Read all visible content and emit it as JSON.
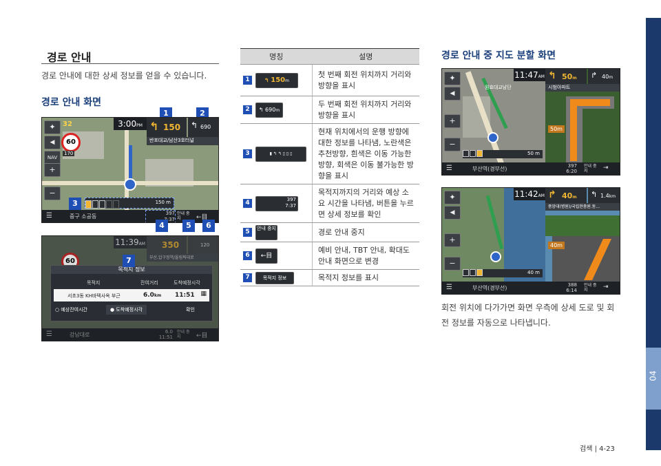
{
  "left": {
    "section_title": "경로 안내",
    "intro": "경로 안내에 대한 상세 정보를 얻을 수 있습니다.",
    "screen_title": "경로 안내 화면",
    "shot1": {
      "clock": "3:00",
      "clock_suffix": "PM",
      "speed": "60",
      "speed_small": "32",
      "dist_main": "150",
      "dist_unit": "m",
      "next_dist": "690",
      "next_unit": "m",
      "road_name": "반포대교/남산3호터널",
      "bottom_address": "중구 소공동",
      "remaining": "397",
      "eta": "7:37",
      "eta_suffix": "PM",
      "stop_label": "안내 중지",
      "lane_dist": "150 m",
      "scale": "170",
      "nav_label": "NAV"
    },
    "shot1_markers": [
      "1",
      "2",
      "3",
      "4",
      "5",
      "6"
    ],
    "shot2": {
      "clock": "11:39",
      "clock_suffix": "AM",
      "speed": "60",
      "dist_main": "350",
      "next_dist": "120",
      "road_name": "부산,압구정역/올림픽대로",
      "panel_title": "목적지 정보",
      "col_dest": "목적지",
      "col_remaining": "잔여거리",
      "col_eta": "도착예정시각",
      "dest_value": "서초3동 KH바텍사옥 부근",
      "remaining_value": "6.0",
      "remaining_unit": "km",
      "eta_value": "11:51",
      "option_remaining_time": "예상잔여시간",
      "option_eta": "도착예정시각",
      "confirm": "확인",
      "bottom_road": "강남대로",
      "bottom_remaining": "6.0",
      "bottom_eta": "11:51",
      "stop_label": "안내 중지"
    },
    "shot2_marker": "7"
  },
  "table": {
    "col_name": "명칭",
    "col_desc": "설명",
    "rows": [
      {
        "num": "1",
        "icon_text": "150",
        "icon_unit": "m",
        "desc": "첫 번째 회전 위치까지 거리와 방향을 표시"
      },
      {
        "num": "2",
        "icon_text": "690",
        "icon_unit": "m",
        "desc": "두 번째 회전 위치까지 거리와 방향을 표시"
      },
      {
        "num": "3",
        "icon_text": "",
        "icon_unit": "",
        "desc": "현재 위치에서의 운행 방향에 대한 정보를 나타냄, 노란색은 추천방향, 흰색은 이동 가능한 방향, 회색은 이동 불가능한 방향을 표시"
      },
      {
        "num": "4",
        "icon_text": "397",
        "icon_unit": "7:37",
        "desc": "목적지까지의 거리와 예상 소요 시간을 나타냄, 버튼을 누르면 상세 정보를 확인"
      },
      {
        "num": "5",
        "icon_text": "안내 중지",
        "icon_unit": "",
        "desc": "경로 안내 중지"
      },
      {
        "num": "6",
        "icon_text": "←目",
        "icon_unit": "",
        "desc": "예비 안내, TBT 안내, 확대도 안내 화면으로 변경"
      },
      {
        "num": "7",
        "icon_text": "목적지 정보",
        "icon_unit": "",
        "desc": "목적지 정보를 표시"
      }
    ]
  },
  "right": {
    "title": "경로 안내 중 지도 분할 화면",
    "shot3": {
      "clock": "11:47",
      "clock_suffix": "AM",
      "dist_main": "50",
      "dist_unit": "m",
      "next_dist": "40",
      "next_unit": "m",
      "poi": "시범아파트",
      "map_label": "원효대교남단",
      "box_dist": "50m",
      "lane_dist": "50 m",
      "bottom_road": "부산역(경부선)",
      "remaining": "397",
      "eta": "6:20",
      "eta_suffix": "PM",
      "stop_label": "안내 중지"
    },
    "shot4": {
      "clock": "11:42",
      "clock_suffix": "AM",
      "dist_main": "40",
      "dist_unit": "m",
      "next_dist": "1.4",
      "next_unit": "km",
      "poi": "중앙대(병원)/국립현충원.동...",
      "box_dist": "40m",
      "lane_dist": "40 m",
      "bottom_road": "부산역(경부선)",
      "remaining": "388",
      "eta": "6:14",
      "eta_suffix": "PM",
      "stop_label": "안내 중지"
    },
    "caption": "회전 위치에 다가가면 화면 우측에 상세 도로 및 회전 정보를 자동으로 나타냅니다."
  },
  "footer": {
    "page": "검색 | 4-23"
  },
  "side_tab": {
    "chapter": "04"
  },
  "colors": {
    "marker": "#1f4fb5",
    "side_tab": "#1b3a6b",
    "side_chip": "#7fa0cc",
    "route": "#2f64c9",
    "turn_arrow": "#f0b531"
  }
}
